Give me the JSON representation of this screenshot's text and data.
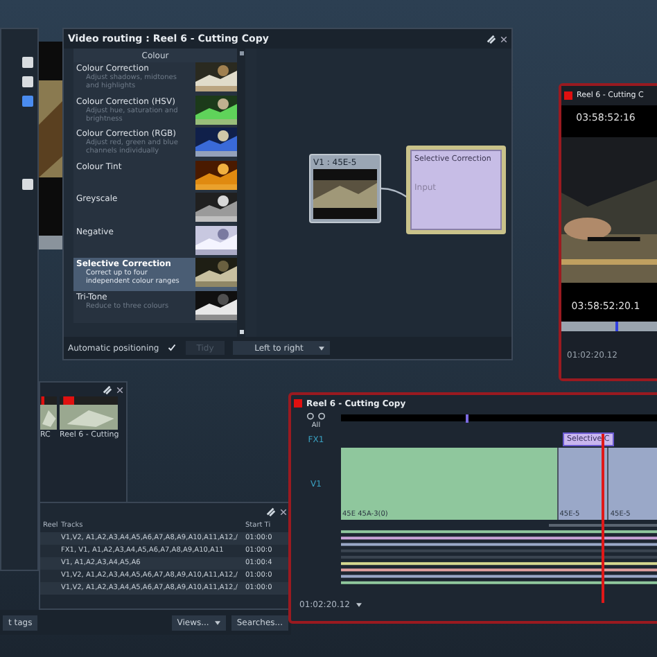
{
  "routing_window": {
    "title": "Video routing : Reel 6 - Cutting Copy",
    "category": "Colour",
    "effects": [
      {
        "name": "Colour Correction",
        "description": "Adjust shadows, midtones and highlights",
        "selected": false
      },
      {
        "name": "Colour Correction (HSV)",
        "description": "Adjust hue, saturation and brightness",
        "selected": false
      },
      {
        "name": "Colour Correction (RGB)",
        "description": "Adjust red, green and blue channels individually",
        "selected": false
      },
      {
        "name": "Colour Tint",
        "selected": false
      },
      {
        "name": "Greyscale",
        "selected": false
      },
      {
        "name": "Negative",
        "selected": false
      },
      {
        "name": "Selective Correction",
        "description": "Correct up to four independent colour ranges",
        "selected": true
      },
      {
        "name": "Tri-Tone",
        "description": "Reduce to three colours",
        "selected": false
      }
    ],
    "nodes": [
      {
        "kind": "clip",
        "title": "V1 : 45E-5"
      },
      {
        "kind": "effect",
        "title": "Selective Correction",
        "input": "Input"
      }
    ],
    "auto_positioning": {
      "label": "Automatic positioning",
      "checked": true
    },
    "tidy": {
      "label": "Tidy",
      "disabled": true
    },
    "direction": "Left to right"
  },
  "viewer": {
    "title": "Reel 6 - Cutting C",
    "timecode_top": "03:58:52:16",
    "timecode_bottom": "03:58:52:20.1",
    "level": 0.55,
    "position": "01:02:20.12"
  },
  "bin": {
    "items": [
      {
        "label": "RC"
      },
      {
        "label": "Reel 6 - Cutting"
      }
    ]
  },
  "table": {
    "columns": [
      "Reel",
      "Tracks",
      "Start Ti"
    ],
    "rows": [
      [
        "",
        "V1,V2, A1,A2,A3,A4,A5,A6,A7,A8,A9,A10,A11,A12,/",
        "01:00:0"
      ],
      [
        "",
        "FX1, V1, A1,A2,A3,A4,A5,A6,A7,A8,A9,A10,A11",
        "01:00:0"
      ],
      [
        "",
        "V1, A1,A2,A3,A4,A5,A6",
        "01:00:4"
      ],
      [
        "",
        "V1,V2, A1,A2,A3,A4,A5,A6,A7,A8,A9,A10,A11,A12,/",
        "01:00:0"
      ],
      [
        "",
        "V1,V2, A1,A2,A3,A4,A5,A6,A7,A8,A9,A10,A11,A12,/",
        "01:00:0"
      ]
    ]
  },
  "bottom_bar": {
    "buttons": [
      {
        "label": "t tags",
        "kind": "button"
      },
      {
        "label": "Views...",
        "kind": "dropdown"
      },
      {
        "label": "Searches...",
        "kind": "button"
      }
    ]
  },
  "timeline": {
    "title": "Reel 6 - Cutting Copy",
    "all": "All",
    "position": "01:02:20.12",
    "tracks": [
      {
        "label": "FX1",
        "kind": "fx",
        "clips": [
          {
            "label": "Selective C",
            "color": "#c9b6ee"
          }
        ]
      },
      {
        "label": "V1",
        "kind": "video",
        "clips": [
          {
            "label": "45E 45A-3(0)",
            "color": "#8fc79d"
          },
          {
            "label": "45E-5",
            "color": "#9aa8c8"
          },
          {
            "label": "45E-5",
            "color": "#9aa8c8"
          }
        ]
      }
    ]
  }
}
